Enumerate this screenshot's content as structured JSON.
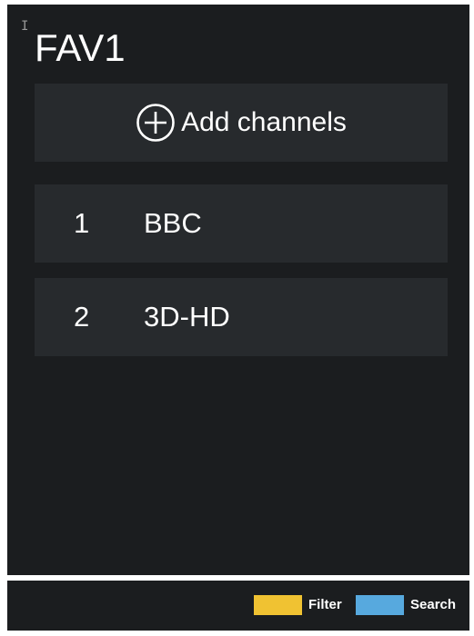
{
  "cursor_glyph": "I",
  "header": {
    "title": "FAV1"
  },
  "add_channels": {
    "icon": "plus-circle-icon",
    "label": "Add channels"
  },
  "channels": [
    {
      "number": "1",
      "name": "BBC"
    },
    {
      "number": "2",
      "name": "3D-HD"
    }
  ],
  "footer": {
    "filter": {
      "label": "Filter",
      "color": "#f0c232"
    },
    "search": {
      "label": "Search",
      "color": "#57a9de"
    }
  },
  "colors": {
    "background": "#1b1d1f",
    "row": "#272a2d",
    "text": "#ffffff"
  }
}
